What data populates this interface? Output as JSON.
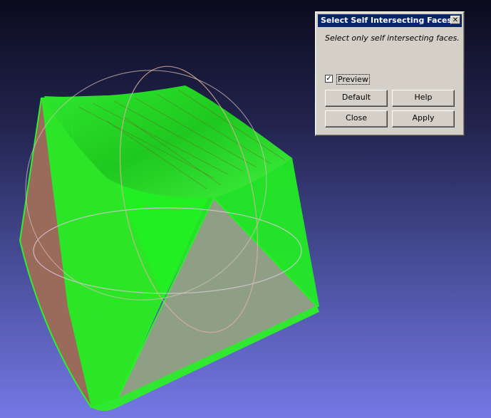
{
  "dialog": {
    "title": "Select Self Intersecting Faces",
    "close_glyph": "✕",
    "description": "Select only self intersecting faces.",
    "preview_label": "Preview",
    "preview_checked": true,
    "check_glyph": "✓",
    "buttons": {
      "default": "Default",
      "help": "Help",
      "close": "Close",
      "apply": "Apply"
    }
  },
  "viewport": {
    "background_top": "#0b0b1e",
    "background_bottom": "#7478e4",
    "face_highlight_color": "#1ef41e",
    "mesh_face_color": "#9a6a5a"
  }
}
